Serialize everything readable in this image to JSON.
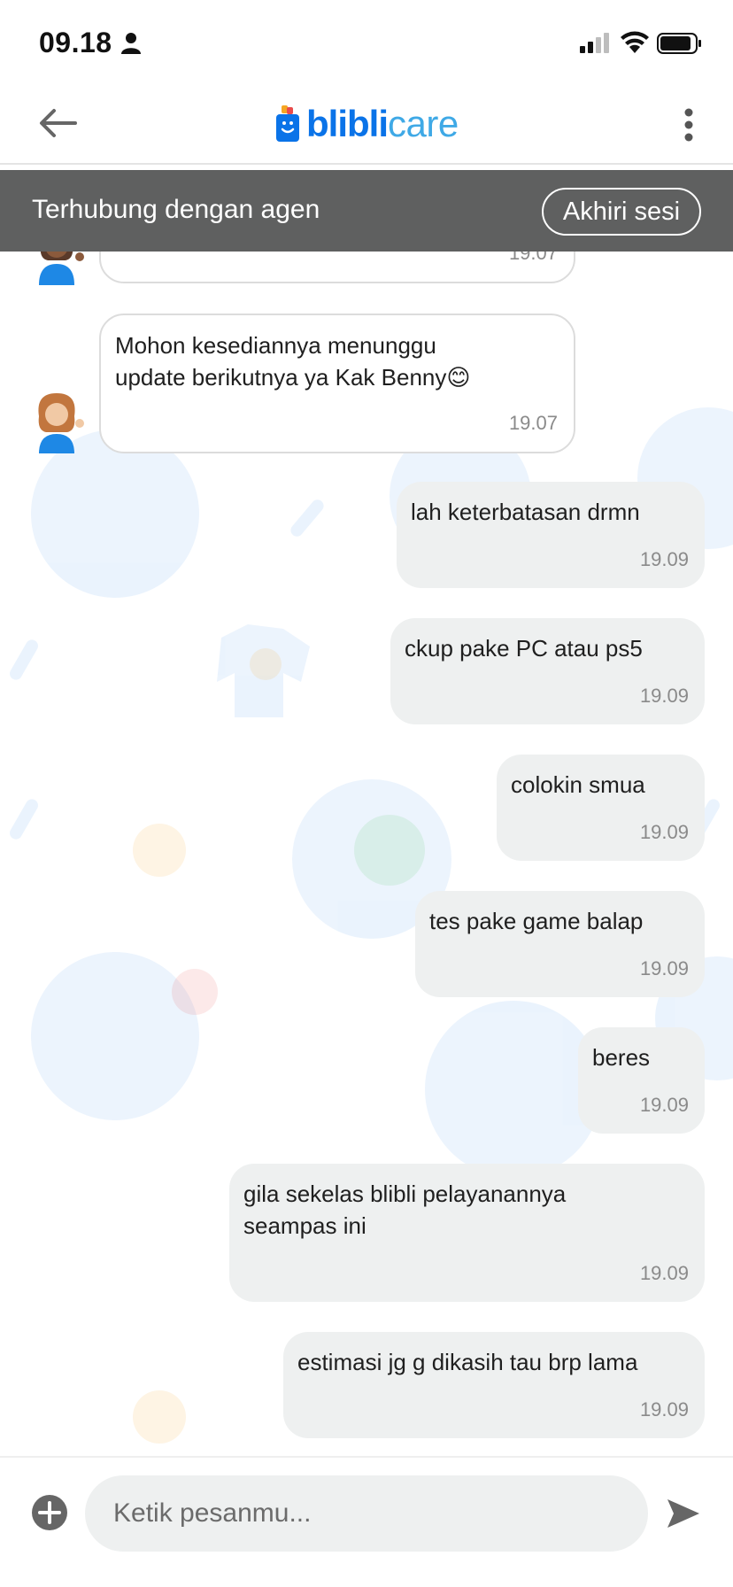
{
  "status_bar": {
    "time": "09.18"
  },
  "header": {
    "logo_brand": "blibli",
    "logo_suffix": "care"
  },
  "session": {
    "text": "Terhubung dengan agen",
    "end_button": "Akhiri sesi"
  },
  "messages": [
    {
      "side": "in",
      "text": "",
      "time": "19.07"
    },
    {
      "side": "in",
      "text": "Mohon kesediannya menunggu\nupdate berikutnya ya Kak Benny😊",
      "time": "19.07"
    },
    {
      "side": "out",
      "text": "lah keterbatasan drmn",
      "time": "19.09"
    },
    {
      "side": "out",
      "text": "ckup pake PC atau ps5",
      "time": "19.09"
    },
    {
      "side": "out",
      "text": "colokin smua",
      "time": "19.09"
    },
    {
      "side": "out",
      "text": "tes pake game balap",
      "time": "19.09"
    },
    {
      "side": "out",
      "text": "beres",
      "time": "19.09"
    },
    {
      "side": "out",
      "text": "gila sekelas blibli pelayanannya\nseampas ini",
      "time": "19.09"
    },
    {
      "side": "out",
      "text": "estimasi jg g dikasih tau brp lama",
      "time": "19.09"
    }
  ],
  "composer": {
    "placeholder": "Ketik pesanmu..."
  },
  "colors": {
    "banner": "#5f6060",
    "brand_blue": "#0a73e8",
    "bubble_out": "#eef0f0",
    "timestamp": "#8a8a8a"
  },
  "icons": [
    "person-icon",
    "signal-icon",
    "wifi-icon",
    "battery-icon",
    "back-arrow-icon",
    "more-vertical-icon",
    "agent-avatar",
    "add-circle-icon",
    "send-icon"
  ]
}
